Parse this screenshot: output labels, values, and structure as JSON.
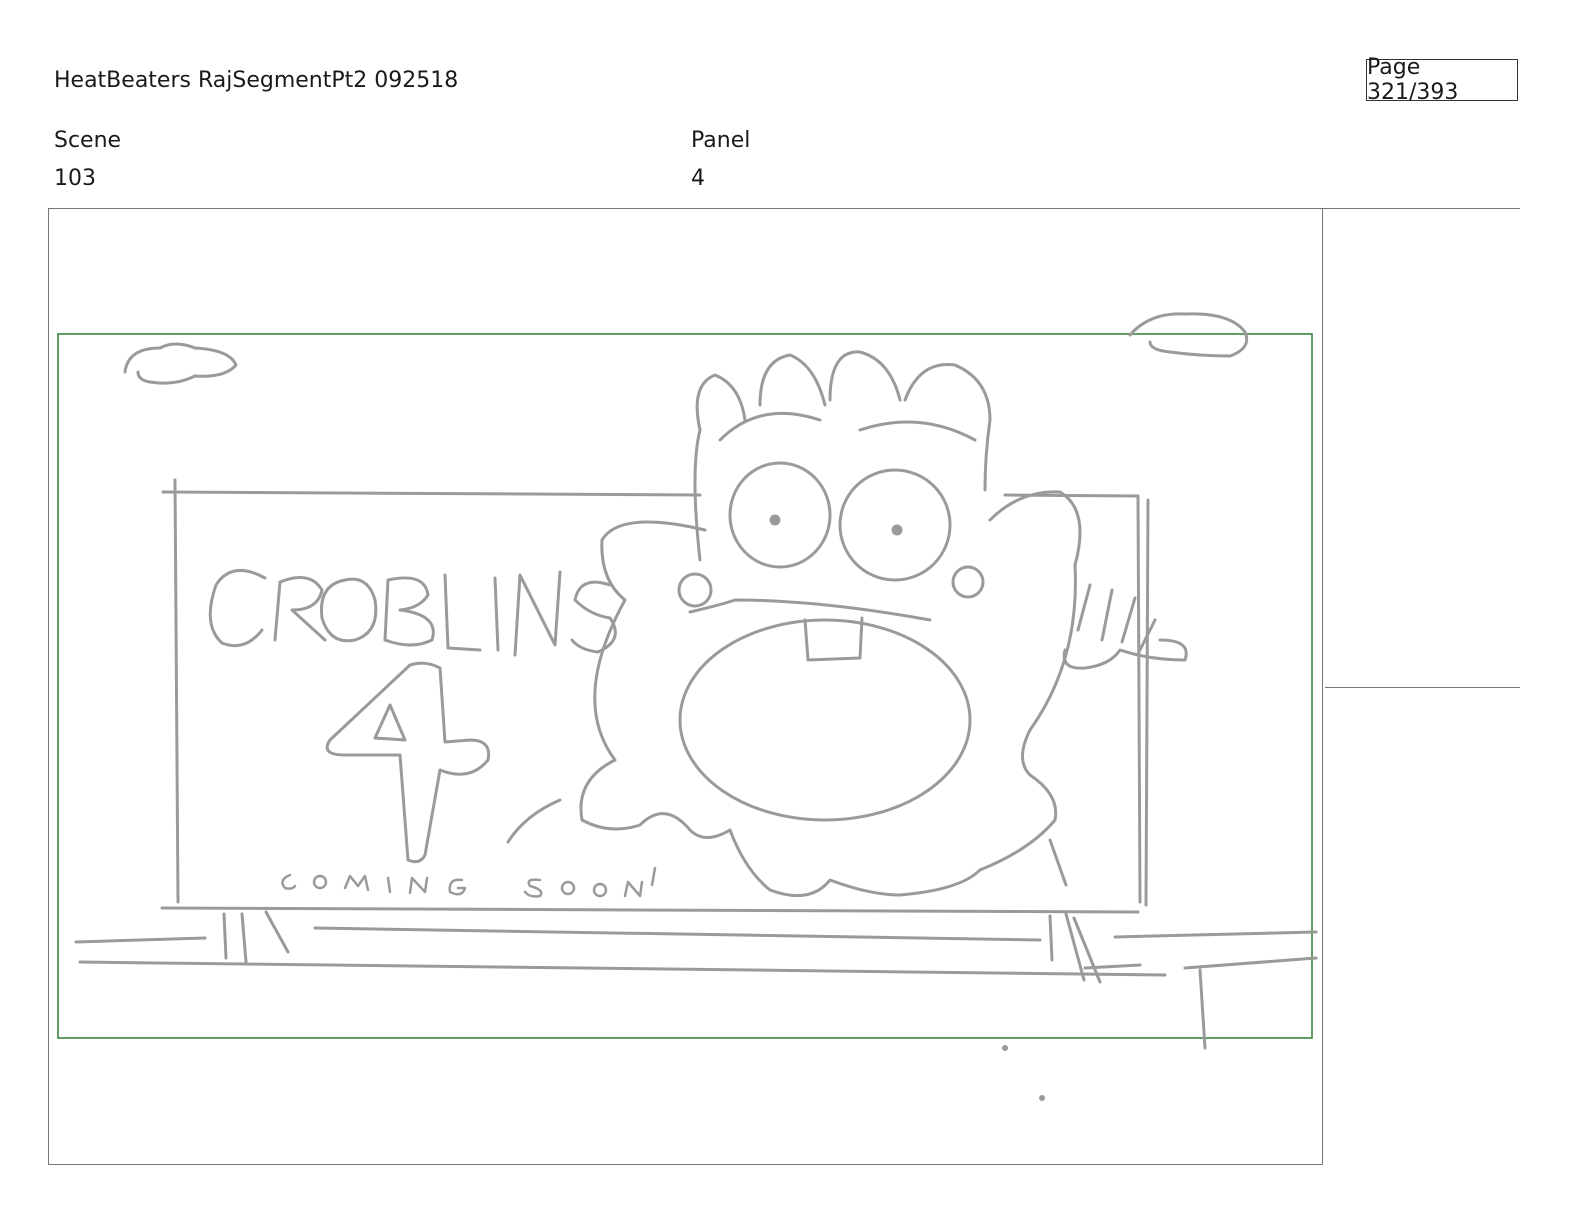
{
  "document": {
    "title": "HeatBeaters RajSegmentPt2 092518",
    "page_label": "Page 321/393"
  },
  "header": {
    "scene_label": "Scene",
    "scene_value": "103",
    "panel_label": "Panel",
    "panel_value": "4"
  },
  "sketch": {
    "billboard_title": "CROBLINS",
    "billboard_number": "4",
    "billboard_tagline": "COMING SOON!",
    "colors": {
      "pencil": "#9a9a9a",
      "safe_area": "#2e7d32",
      "frame": "#777777"
    }
  }
}
